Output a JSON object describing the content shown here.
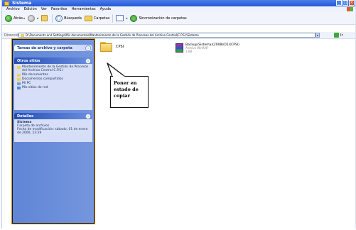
{
  "window": {
    "title": "Sistema"
  },
  "menubar": {
    "items": [
      "Archivo",
      "Edición",
      "Ver",
      "Favoritos",
      "Herramientas",
      "Ayuda"
    ]
  },
  "toolbar": {
    "back_label": "Atrás",
    "search_label": "Búsqueda",
    "folders_label": "Carpetas",
    "sync_label": "Sincronización de carpetas"
  },
  "addressbar": {
    "label": "Dirección",
    "path": "D:\\Documents and Settings\\Mis documentos\\Mantenimiento de la Gestión de Procesos del Archivo Central\\C.P.S.I\\Sistema",
    "go_label": "Ir"
  },
  "taskpane": {
    "tasks_header": "Tareas de archivo y carpeta",
    "places_header": "Otros sitios",
    "places": [
      {
        "label": "Mantenimiento de la Gestión de Procesos del Archivo Central C.P.S.I",
        "icon": "folder-icon"
      },
      {
        "label": "Mis documentos",
        "icon": "folder-icon"
      },
      {
        "label": "Documentos compartidos",
        "icon": "folder-icon"
      },
      {
        "label": "Mi PC",
        "icon": "computer-icon"
      },
      {
        "label": "Mis sitios de red",
        "icon": "network-icon"
      }
    ],
    "details_header": "Detalles",
    "details": {
      "name": "Sistema",
      "type": "Carpeta de archivos",
      "modified": "Fecha de modificación: sábado, 01 de enero de 2000, 23:59"
    }
  },
  "content": {
    "folder_item": {
      "label": "CPSI"
    },
    "archive_item": {
      "name": "Backup(Sistema)(2008)(01)(CPSI)",
      "type": "Archivo WinRAR",
      "size": "1 KB"
    }
  },
  "callout": {
    "text": "Poner en\nestado de\ncopiar"
  },
  "colors": {
    "titlebar": "#2458d8",
    "taskpane": "#6b8fdc",
    "callout_border": "#111111"
  }
}
